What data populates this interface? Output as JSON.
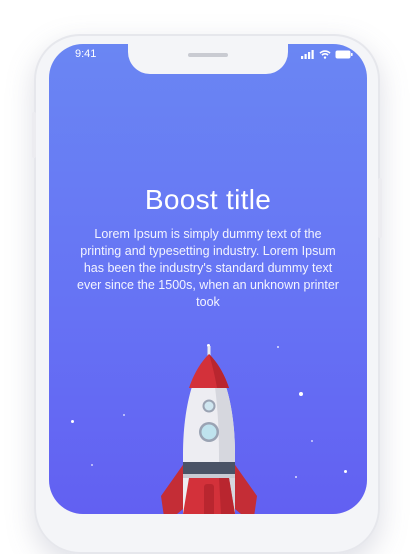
{
  "status_bar": {
    "time": "9:41"
  },
  "boost": {
    "title": "Boost title",
    "description": "Lorem Ipsum is simply dummy text of the printing and typesetting industry. Lorem Ipsum has been the industry's standard dummy text ever since the 1500s, when an unknown printer took"
  },
  "colors": {
    "screen_gradient_top": "#6a86f3",
    "screen_gradient_bottom": "#6260f2",
    "rocket_red": "#d3313a",
    "rocket_body": "#e9e9ee"
  },
  "icons": [
    "signal-icon",
    "wifi-icon",
    "battery-icon",
    "rocket-illustration"
  ]
}
